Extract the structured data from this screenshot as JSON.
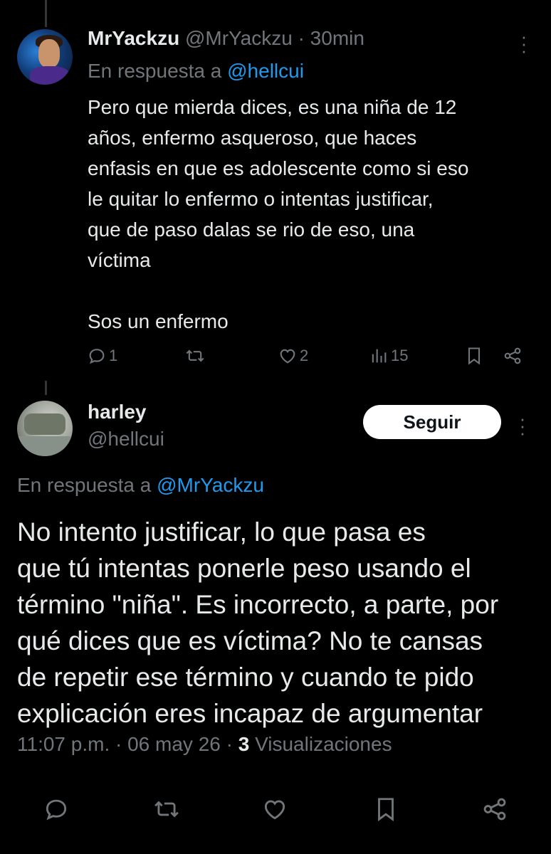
{
  "reply_tweet": {
    "display_name": "MrYackzu",
    "handle": "@MrYackzu",
    "separator": "·",
    "time": "30min",
    "reply_prefix": "En respuesta a",
    "reply_to": "@hellcui",
    "text": "Pero que mierda dices, es una niña de 12\naños, enfermo asqueroso, que haces\nenfasis en que es adolescente como si eso\nle quitar lo enfermo o intentas justificar,\nque de paso dalas se rio de eso, una\nvíctima\n\nSos un enfermo",
    "replies": "1",
    "likes": "2",
    "views": "15"
  },
  "main_tweet": {
    "display_name": "harley",
    "handle": "@hellcui",
    "follow_label": "Seguir",
    "reply_prefix": "En respuesta a",
    "reply_to": "@MrYackzu",
    "text": "No intento justificar, lo que pasa es\nque tú intentas ponerle peso usando el\ntérmino \"niña\". Es incorrecto, a parte, por\nqué dices que es víctima? No te cansas\nde repetir ese término y cuando te pido\nexplicación eres incapaz de argumentar",
    "timestamp": "11:07 p.m. · 06 may 26 · ",
    "view_count": "3",
    "view_label": " Visualizaciones"
  },
  "icons": {
    "reply": "reply-icon",
    "retweet": "retweet-icon",
    "like": "heart-icon",
    "views": "views-icon",
    "bookmark": "bookmark-icon",
    "share": "share-icon",
    "more": "more-vertical-icon"
  },
  "colors": {
    "background": "#000000",
    "text": "#e7e9ea",
    "muted": "#71767b",
    "link": "#1d9bf0"
  }
}
